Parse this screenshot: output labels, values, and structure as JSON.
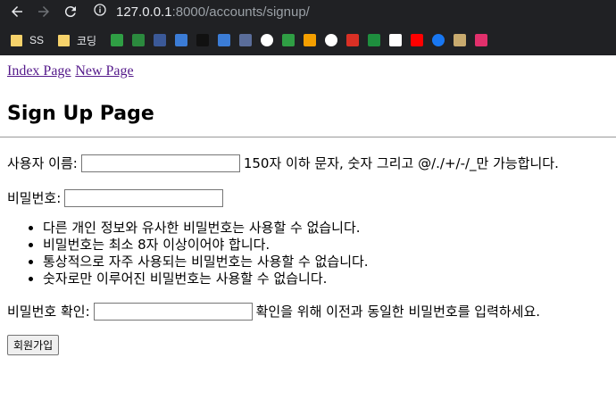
{
  "browser": {
    "url_host": "127.0.0.1",
    "url_rest": ":8000/accounts/signup/",
    "bookmarks": [
      {
        "name": "SS",
        "icon": "folder-icon"
      },
      {
        "name": "코딩",
        "icon": "folder-icon"
      },
      {
        "name": "",
        "icon": "notion-n-icon",
        "color": "#2f9e44"
      },
      {
        "name": "",
        "icon": "dash-icon",
        "color": "#2f9e44"
      },
      {
        "name": "",
        "icon": "feather-icon",
        "color": "#3b5998"
      },
      {
        "name": "",
        "icon": "vscode-icon",
        "color": "#3b7cd6"
      },
      {
        "name": "",
        "icon": "terminal-icon",
        "color": "#111111"
      },
      {
        "name": "",
        "icon": "s-icon",
        "color": "#3b7cd6"
      },
      {
        "name": "",
        "icon": "code-icon",
        "color": "#5a6d9a"
      },
      {
        "name": "",
        "icon": "github-icon",
        "color": "#ffffff"
      },
      {
        "name": "",
        "icon": "ac-icon",
        "color": "#2f9e44"
      },
      {
        "name": "",
        "icon": "warning-icon",
        "color": "#f59f00"
      },
      {
        "name": "",
        "icon": "google-icon",
        "color": "#ffffff"
      },
      {
        "name": "",
        "icon": "gmail-icon",
        "color": "#d93025"
      },
      {
        "name": "",
        "icon": "drive-icon",
        "color": "#1e8e3e"
      },
      {
        "name": "",
        "icon": "notion-icon",
        "color": "#ffffff"
      },
      {
        "name": "",
        "icon": "youtube-icon",
        "color": "#ff0000"
      },
      {
        "name": "",
        "icon": "facebook-icon",
        "color": "#1877f2"
      },
      {
        "name": "",
        "icon": "league-icon",
        "color": "#c8aa6e"
      },
      {
        "name": "",
        "icon": "instagram-icon",
        "color": "#e1306c"
      }
    ]
  },
  "nav": {
    "index_label": "Index Page",
    "new_label": "New Page"
  },
  "page_title": "Sign Up Page",
  "form": {
    "username_label": "사용자 이름:",
    "username_value": "",
    "username_help": "150자 이하 문자, 숫자 그리고 @/./+/-/_만 가능합니다.",
    "password_label": "비밀번호:",
    "password_value": "",
    "password_rules": [
      "다른 개인 정보와 유사한 비밀번호는 사용할 수 없습니다.",
      "비밀번호는 최소 8자 이상이어야 합니다.",
      "통상적으로 자주 사용되는 비밀번호는 사용할 수 없습니다.",
      "숫자로만 이루어진 비밀번호는 사용할 수 없습니다."
    ],
    "confirm_label": "비밀번호 확인:",
    "confirm_value": "",
    "confirm_help": "확인을 위해 이전과 동일한 비밀번호를 입력하세요.",
    "submit_label": "회원가입"
  }
}
